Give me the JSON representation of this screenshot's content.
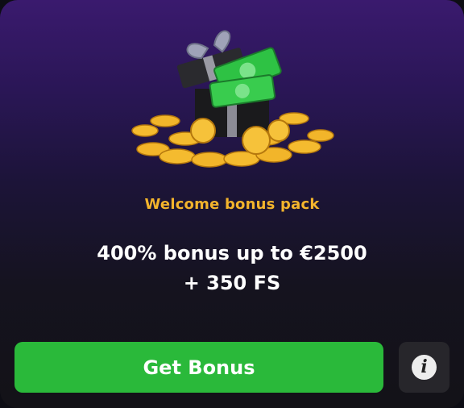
{
  "offer": {
    "subtitle": "Welcome bonus pack",
    "headline_line1": "400% bonus up to €2500",
    "headline_line2": "+ 350 FS"
  },
  "actions": {
    "get_bonus_label": "Get Bonus",
    "info_icon": "i"
  },
  "colors": {
    "accent": "#f3b42c",
    "button": "#2ab93a",
    "info_bg": "#27262b"
  },
  "icons": {
    "hero": "gift-box-with-coins-icon",
    "info": "info-icon"
  }
}
